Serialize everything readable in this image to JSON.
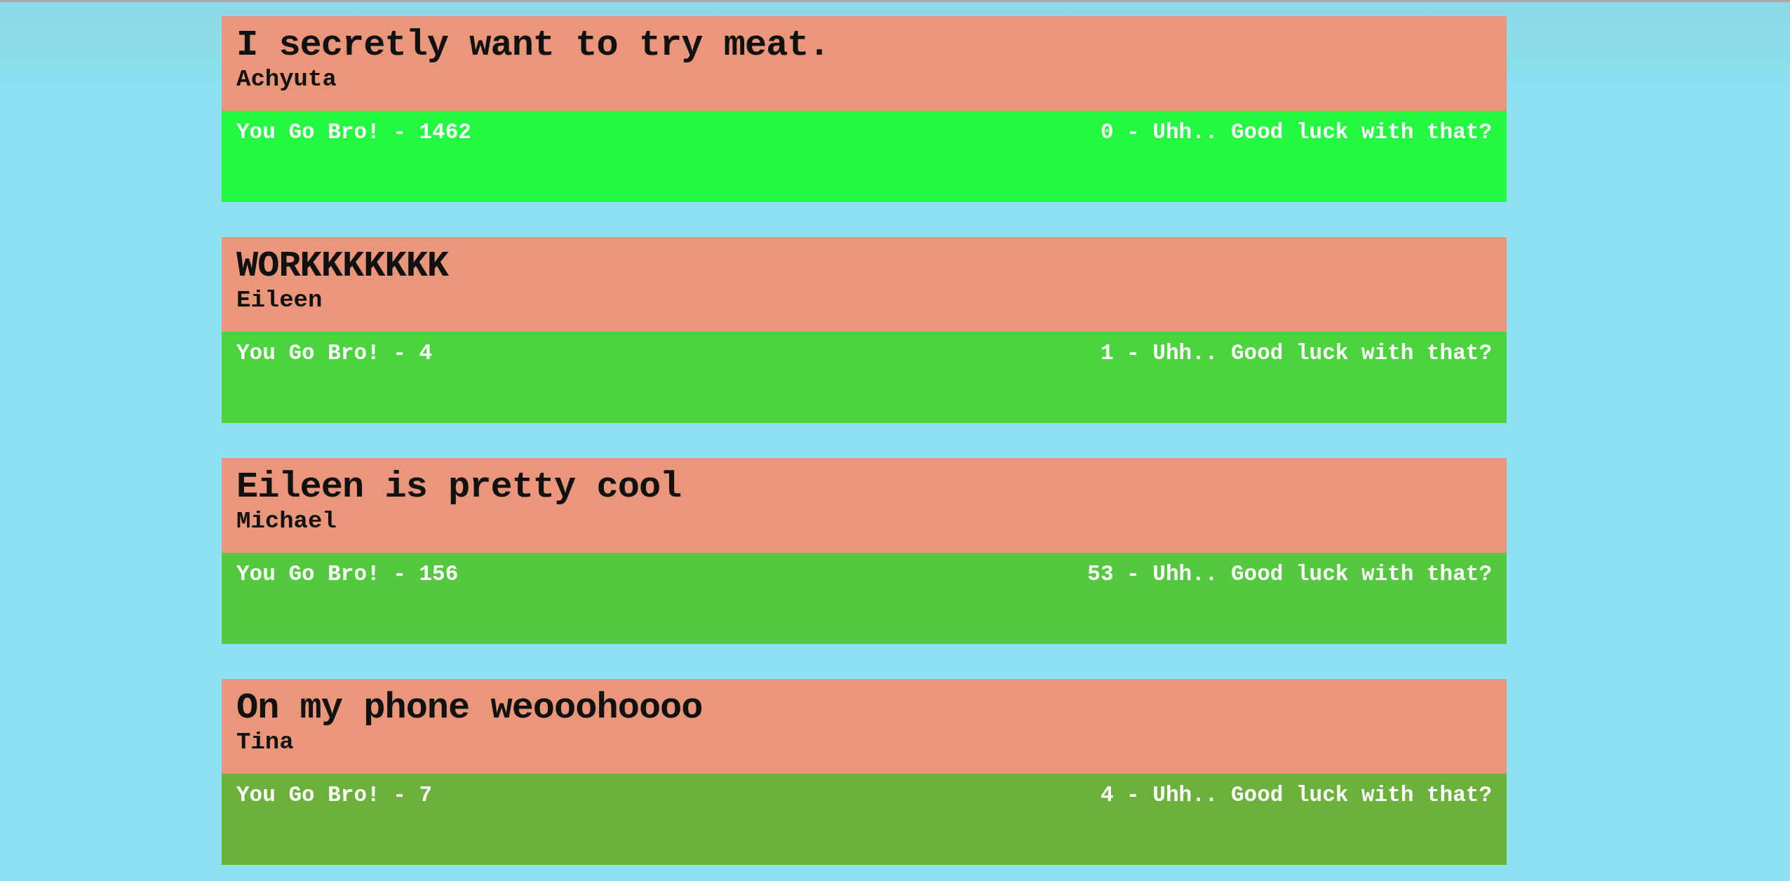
{
  "posts": [
    {
      "title": "I secretly want to try meat.",
      "author": "Achyuta",
      "up": "You Go Bro! - 1462",
      "down": "0 - Uhh.. Good luck with that?",
      "color": "#24f942"
    },
    {
      "title": "WORKKKKKKK",
      "author": "Eileen",
      "up": "You Go Bro! - 4",
      "down": "1 - Uhh.. Good luck with that?",
      "color": "#4cd43f"
    },
    {
      "title": "Eileen is pretty cool",
      "author": "Michael",
      "up": "You Go Bro! - 156",
      "down": "53 - Uhh.. Good luck with that?",
      "color": "#54c940"
    },
    {
      "title": "On my phone weooohoooo",
      "author": "Tina",
      "up": "You Go Bro! - 7",
      "down": "4 - Uhh.. Good luck with that?",
      "color": "#6bb13c"
    }
  ]
}
